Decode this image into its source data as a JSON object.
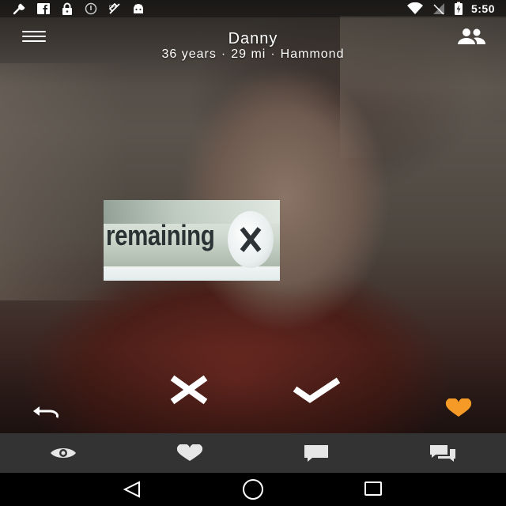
{
  "status_bar": {
    "time": "5:50",
    "left_icons": [
      "wrench-icon",
      "facebook-icon",
      "lock-icon",
      "info-icon",
      "no-location-icon",
      "android-icon"
    ],
    "right_icons": [
      "wifi-icon",
      "no-signal-icon",
      "battery-charging-icon"
    ]
  },
  "header": {
    "name": "Danny",
    "age": "36 years",
    "distance": "29 mi",
    "location": "Hammond",
    "separator": "·"
  },
  "overlay": {
    "text": "remaining"
  },
  "colors": {
    "accent_heart": "#f59a26",
    "nav_bg": "#333333",
    "icon": "#ffffff",
    "nav_icon": "#e6e6e6"
  },
  "actions": [
    "undo-icon",
    "close-icon",
    "check-icon",
    "heart-icon"
  ],
  "bottom_nav": [
    "eye-icon",
    "heart-icon",
    "message-icon",
    "chat-icon"
  ],
  "system_nav": [
    "back-icon",
    "home-icon",
    "recents-icon"
  ]
}
